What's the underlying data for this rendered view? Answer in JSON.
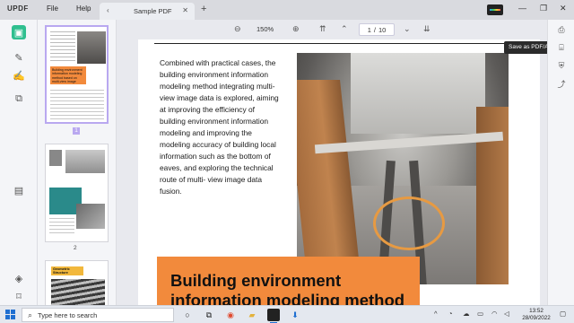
{
  "app": {
    "logo": "UPDF",
    "menu": [
      "File",
      "Help"
    ],
    "tab": {
      "title": "Sample PDF",
      "chevron_icon": "chevron-left-icon",
      "close_icon": "close-icon"
    },
    "new_tab_symbol": "+",
    "window_controls": [
      "—",
      "❐",
      "✕"
    ]
  },
  "toolbar": {
    "zoom_out_symbol": "⊖",
    "zoom": "150%",
    "zoom_in_symbol": "⊕",
    "first_page_symbol": "⇈",
    "prev_page_symbol": "⌃",
    "current_page": "1",
    "page_separator": "/",
    "total_pages": "10",
    "next_page_symbol": "⌄",
    "last_page_symbol": "⇊"
  },
  "thumbnails": [
    {
      "page_label": "1",
      "selected": true,
      "caption": "Building environment information modeling method based on multi-view image"
    },
    {
      "page_label": "2",
      "selected": false
    },
    {
      "page_label": "3",
      "selected": false,
      "caption": "Geometric Structure"
    }
  ],
  "document": {
    "body_text": "Combined with practical cases, the building environment information modeling method integrating multi-view image data is explored, aiming at improving the efficiency of building environment information modeling and improving the modeling accuracy of building local information such as the bottom of eaves, and exploring the technical route of multi- view image data fusion.",
    "banner_title": "Building environment information modeling method"
  },
  "right_panel": {
    "tooltip": "Save as PDF/A"
  },
  "taskbar": {
    "search_placeholder": "Type here to search",
    "tray_chevron": "^",
    "time": "13:52",
    "date": "28/09/2022"
  },
  "colors": {
    "accent_green": "#2fbf8f",
    "banner_orange": "#f28a3c",
    "selection_purple": "#b9a8f0"
  }
}
